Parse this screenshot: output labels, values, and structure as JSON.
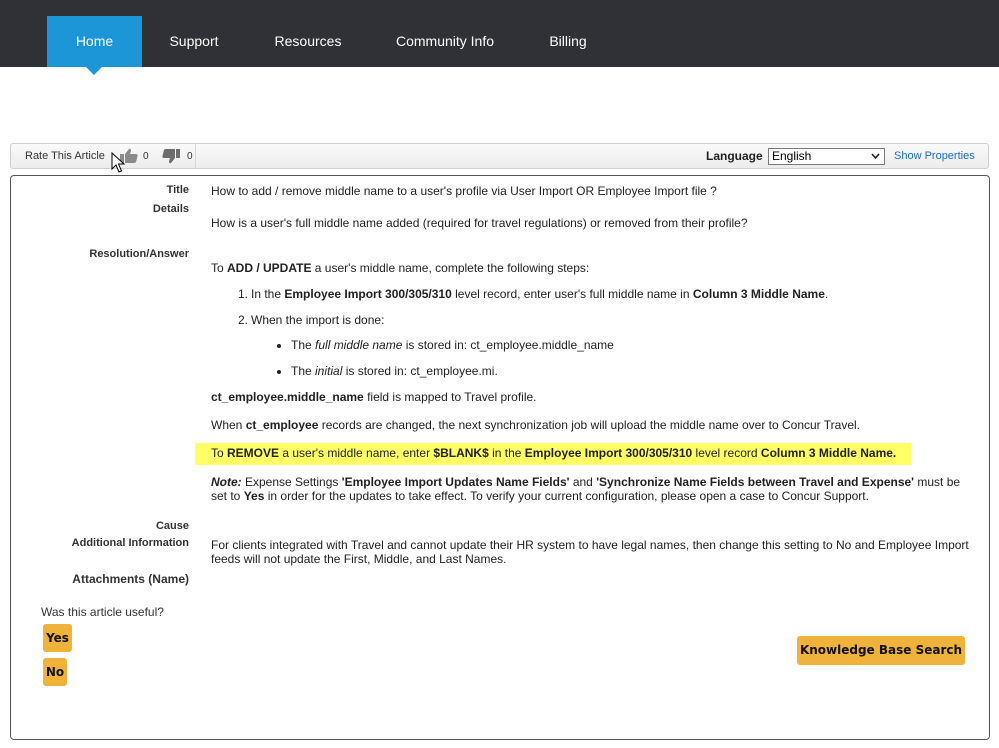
{
  "nav": {
    "items": [
      {
        "label": "Home",
        "active": true
      },
      {
        "label": "Support",
        "active": false
      },
      {
        "label": "Resources",
        "active": false
      },
      {
        "label": "Community Info",
        "active": false
      },
      {
        "label": "Billing",
        "active": false
      }
    ]
  },
  "toolbar": {
    "rate_label": "Rate This Article",
    "thumbs_up_count": "0",
    "thumbs_down_count": "0",
    "language_label": "Language",
    "language_value": "English",
    "show_properties": "Show Properties"
  },
  "article": {
    "title_label": "Title",
    "title": "How to add / remove middle name to a user's profile via User Import OR Employee Import file ?",
    "details_label": "Details",
    "details": "How is a user's full middle name added (required for travel regulations) or removed from their profile?",
    "resolution_label": "Resolution/Answer",
    "intro_pre": "To ",
    "intro_bold": "ADD / UPDATE",
    "intro_post": " a user's middle name, complete the following steps:",
    "step1_num": "1.",
    "step1_pre": "In the ",
    "step1_bold1": "Employee Import 300/305/310",
    "step1_mid": " level record, enter user's full middle name in ",
    "step1_bold2": "Column 3 Middle Name",
    "step1_post": ".",
    "step2_num": "2.",
    "step2": "When the import is done:",
    "bullet1_pre": "The ",
    "bullet1_em": "full middle name",
    "bullet1_post": " is stored in: ct_employee.middle_name",
    "bullet2_pre": "The ",
    "bullet2_em": "initial",
    "bullet2_post": " is stored in: ct_employee.mi.",
    "mapped_bold": "ct_employee.middle_name",
    "mapped_post": " field is mapped to Travel profile.",
    "sync_pre": "When ",
    "sync_bold": "ct_employee",
    "sync_post": " records are changed, the next synchronization job will upload the middle name over to Concur Travel.",
    "remove_pre": "To ",
    "remove_b1": "REMOVE",
    "remove_m1": " a user's middle name, enter ",
    "remove_b2": "$BLANK$",
    "remove_m2": " in the ",
    "remove_b3": "Employee Import 300/305/310",
    "remove_m3": " level record ",
    "remove_b4": "Column 3 Middle Name.",
    "note_label": "Note:",
    "note_pre": "  Expense Settings ",
    "note_b1": "'Employee Import Updates Name Fields'",
    "note_m1": " and ",
    "note_b2": "'Synchronize Name Fields between Travel and Expense'",
    "note_m2": " must be set to ",
    "note_b3": "Yes",
    "note_post": " in order for the updates to take effect. To verify your current configuration, please open a case to Concur Support.",
    "cause_label": "Cause",
    "additional_label": "Additional Information",
    "additional": "For clients integrated with Travel and cannot update their HR system to have legal names, then change this setting to No and Employee Import feeds will not update the First, Middle, and Last Names.",
    "attachments_label": "Attachments (Name)"
  },
  "feedback": {
    "question": "Was this article useful?",
    "yes": "Yes",
    "no": "No",
    "kb_search": "Knowledge Base Search"
  },
  "colors": {
    "nav_bg": "#2f3136",
    "nav_active": "#1c96d6",
    "highlight": "#ffff66",
    "button": "#efb23a",
    "link": "#1a6ec2"
  }
}
